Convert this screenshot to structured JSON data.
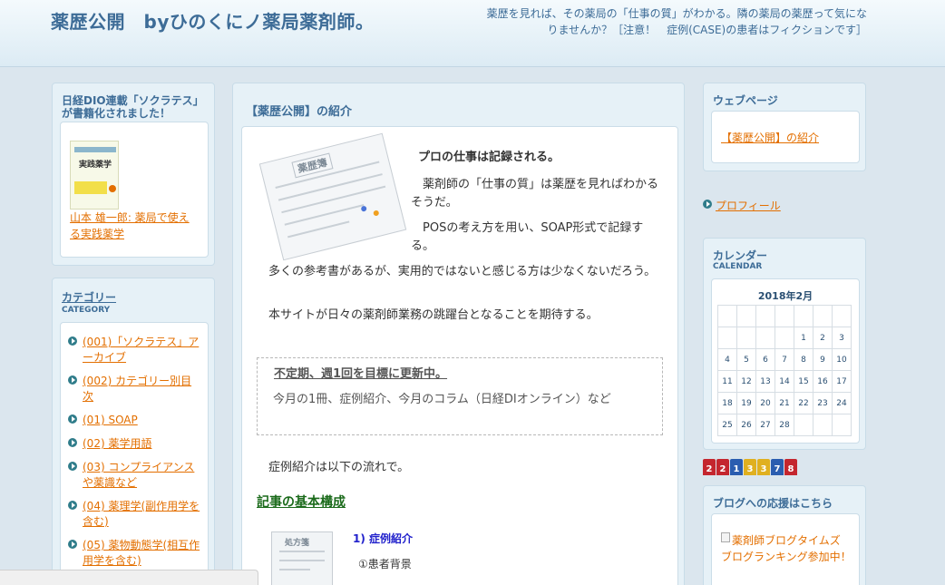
{
  "header": {
    "title": "薬歴公開　byひのくにノ薬局薬剤師。",
    "description": "薬歴を見れば、その薬局の「仕事の質」がわかる。隣の薬局の薬歴って気になりませんか？［注意！　症例(CASE)の患者はフィクションです］"
  },
  "left": {
    "book_box": {
      "title": "日経DIO連載「ソクラテス」が書籍化されました！",
      "cover_text": "実践薬学",
      "link": "山本 雄一郎: 薬局で使える実践薬学"
    },
    "category_box": {
      "title": "カテゴリー",
      "subtitle": "CATEGORY",
      "items": [
        "(001)「ソクラテス」アーカイブ",
        "(002) カテゴリー別目次",
        "(01) SOAP",
        "(02) 薬学用語",
        "(03) コンプライアンスや薬識など",
        "(04) 薬理学(副作用学を含む)",
        "(05) 薬物動態学(相互作用学を含む)"
      ]
    }
  },
  "main": {
    "post_title": "【薬歴公開】の紹介",
    "notebook_label": "薬歴簿",
    "heading1": "プロの仕事は記録される。",
    "para1": "薬剤師の「仕事の質」は薬歴を見ればわかるそうだ。",
    "para2": "POSの考え方を用い、SOAP形式で記録する。",
    "para3": "多くの参考書があるが、実用的ではないと感じる方は少なくないだろう。",
    "para4": "本サイトが日々の薬剤師業務の跳躍台となることを期待する。",
    "notice_title": "不定期、週1回を目標に更新中。",
    "notice_body": "今月の1冊、症例紹介、今月のコラム（日経DIオンライン）など",
    "flow_intro": "症例紹介は以下の流れで。",
    "section_heading": "記事の基本構成",
    "doc_label": "処方箋",
    "step1": "1) 症例紹介",
    "step1_sub": "①患者背景"
  },
  "right": {
    "web_box": {
      "title": "ウェブページ",
      "link": "【薬歴公開】の紹介"
    },
    "profile_link": "プロフィール",
    "calendar": {
      "title": "カレンダー",
      "subtitle": "CALENDAR",
      "month": "2018年2月",
      "rows": [
        [
          "",
          "",
          "",
          "",
          "",
          "",
          ""
        ],
        [
          "",
          "",
          "",
          "",
          "1",
          "2",
          "3"
        ],
        [
          "4",
          "5",
          "6",
          "7",
          "8",
          "9",
          "10"
        ],
        [
          "11",
          "12",
          "13",
          "14",
          "15",
          "16",
          "17"
        ],
        [
          "18",
          "19",
          "20",
          "21",
          "22",
          "23",
          "24"
        ],
        [
          "25",
          "26",
          "27",
          "28",
          "",
          "",
          ""
        ]
      ]
    },
    "counter": {
      "digits": [
        "2",
        "2",
        "1",
        "3",
        "3",
        "7",
        "8"
      ],
      "colors": [
        "#c4262e",
        "#c4262e",
        "#2a5db0",
        "#e0b020",
        "#e0b020",
        "#2a5db0",
        "#c4262e"
      ]
    },
    "blog_box": {
      "title": "ブログへの応援はこちら",
      "image_alt": "薬剤師ブログタイムズ ブログランキング参加中！"
    }
  }
}
